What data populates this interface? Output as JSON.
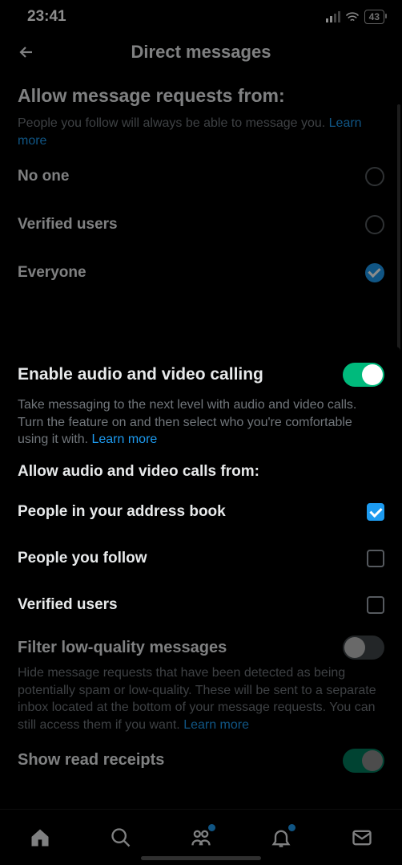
{
  "statusbar": {
    "time": "23:41",
    "battery": "43"
  },
  "header": {
    "title": "Direct messages"
  },
  "section1": {
    "heading": "Allow message requests from:",
    "desc": "People you follow will always be able to message you. ",
    "learn": "Learn more",
    "options": [
      {
        "label": "No one",
        "checked": false
      },
      {
        "label": "Verified users",
        "checked": false
      },
      {
        "label": "Everyone",
        "checked": true
      }
    ]
  },
  "panel": {
    "heading": "Enable audio and video calling",
    "desc": "Take messaging to the next level with audio and video calls. Turn the feature on and then select who you're comfortable using it with. ",
    "learn": "Learn more",
    "sub": "Allow audio and video calls from:",
    "options": [
      {
        "label": "People in your address book",
        "checked": true
      },
      {
        "label": "People you follow",
        "checked": false
      },
      {
        "label": "Verified users",
        "checked": false
      }
    ]
  },
  "filter": {
    "heading": "Filter low-quality messages",
    "desc": "Hide message requests that have been detected as being potentially spam or low-quality. These will be sent to a separate inbox located at the bottom of your message requests. You can still access them if you want. ",
    "learn": "Learn more"
  },
  "receipts": {
    "heading": "Show read receipts"
  }
}
